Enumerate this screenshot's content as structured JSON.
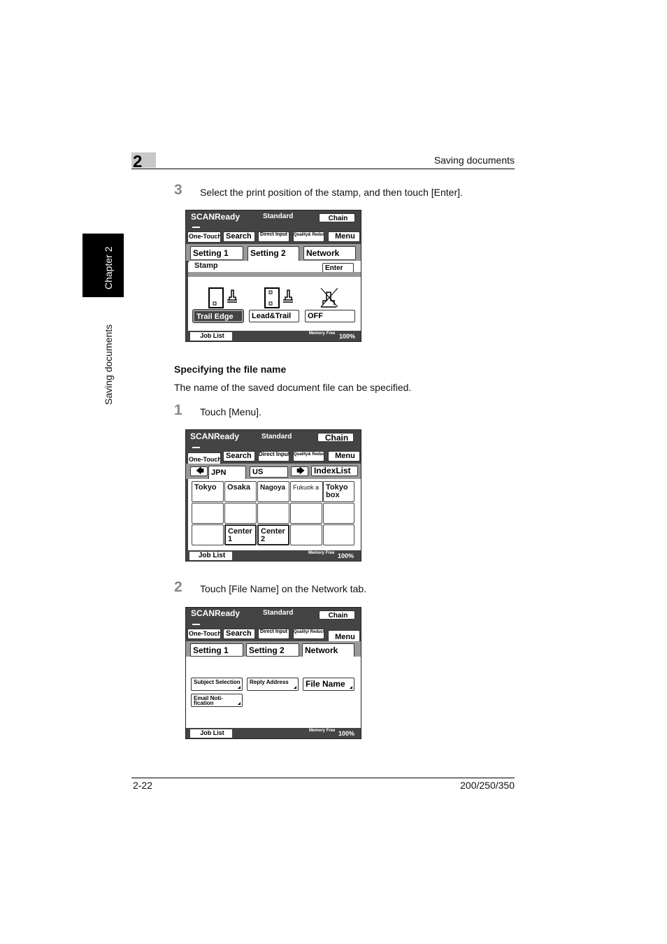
{
  "header": {
    "chapter_number": "2",
    "running_title": "Saving documents"
  },
  "sidebar": {
    "chapter_label": "Chapter 2",
    "section_label": "Saving documents"
  },
  "step3": {
    "number": "3",
    "text": "Select the print position of the stamp, and then touch [Enter]."
  },
  "screen_common": {
    "status": "SCANReady",
    "mode": "Standard",
    "chain": "Chain",
    "tabs": [
      "One-Touch",
      "Search",
      "Direct Input",
      "Quality& Reduction",
      "Menu"
    ],
    "job_list": "Job List",
    "memory_free": "Memory Free",
    "memory_value": "100%"
  },
  "screen1": {
    "subtabs": [
      "Setting 1",
      "Setting 2",
      "Network"
    ],
    "panel_title": "Stamp",
    "enter": "Enter",
    "options": [
      "Trail Edge",
      "Lead&Trail",
      "OFF"
    ],
    "selected": "Trail Edge"
  },
  "section": {
    "heading": "Specifying the file name",
    "intro": "The name of the saved document file can be specified."
  },
  "step1": {
    "number": "1",
    "text": "Touch [Menu]."
  },
  "screen2": {
    "index_tabs": [
      "JPN",
      "US"
    ],
    "index_list": "IndexList",
    "cells": [
      "Tokyo",
      "Osaka",
      "Nagoya",
      "Fukuok a",
      "Tokyo box",
      "",
      "",
      "",
      "",
      "",
      "",
      "Center 1",
      "Center 2",
      "",
      ""
    ]
  },
  "step2": {
    "number": "2",
    "text": "Touch [File Name] on the Network tab."
  },
  "screen3": {
    "quality_tab": "Quality/ Reduction",
    "subtabs": [
      "Setting 1",
      "Setting 2",
      "Network"
    ],
    "buttons": [
      "Subject Selection",
      "Reply Address",
      "File Name",
      "Email Noti- fication"
    ]
  },
  "footer": {
    "page": "2-22",
    "models": "200/250/350"
  }
}
